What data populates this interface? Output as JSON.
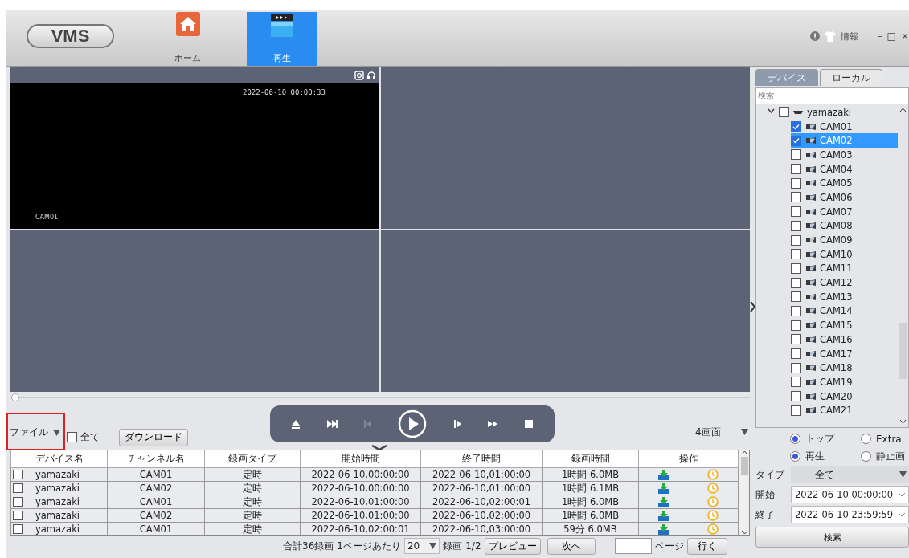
{
  "header": {
    "logo": "VMS",
    "nav": [
      {
        "label": "ホーム",
        "kind": "home",
        "selected": false
      },
      {
        "label": "再生",
        "kind": "playback",
        "selected": true
      }
    ],
    "info_label": "情報",
    "window_controls": [
      "–",
      "□",
      "×"
    ]
  },
  "video": {
    "cells": [
      {
        "kind": "live",
        "timestamp": "2022-06-10 00:00:33",
        "channel": "CAM01"
      },
      {
        "kind": "empty"
      },
      {
        "kind": "empty"
      },
      {
        "kind": "empty"
      }
    ],
    "seek": {
      "level": 0
    }
  },
  "toolbar": {
    "file_filter": {
      "value": "ファイル",
      "highlighted": true
    },
    "all_checkbox": {
      "label": "全て",
      "checked": false
    },
    "download_button": "ダウンロード",
    "layout_select": {
      "value": "4画面"
    },
    "playback_controls": [
      {
        "kind": "eject",
        "disabled": false
      },
      {
        "kind": "next",
        "disabled": false
      },
      {
        "kind": "step_back",
        "disabled": true
      },
      {
        "kind": "play",
        "disabled": false
      },
      {
        "kind": "step_forward",
        "disabled": false
      },
      {
        "kind": "fast_forward",
        "disabled": false
      },
      {
        "kind": "stop",
        "disabled": false
      }
    ]
  },
  "table": {
    "columns": [
      "デバイス名",
      "チャンネル名",
      "録画タイプ",
      "開始時間",
      "終了時間",
      "録画時間",
      "操作"
    ],
    "rows": [
      {
        "checked": false,
        "cells": [
          "yamazaki",
          "CAM01",
          "定時",
          "2022-06-10,00:00:00",
          "2022-06-10,01:00:00",
          "1時間 6.0MB"
        ]
      },
      {
        "checked": false,
        "cells": [
          "yamazaki",
          "CAM02",
          "定時",
          "2022-06-10,00:00:00",
          "2022-06-10,01:00:00",
          "1時間 6.1MB"
        ]
      },
      {
        "checked": false,
        "cells": [
          "yamazaki",
          "CAM01",
          "定時",
          "2022-06-10,01:00:00",
          "2022-06-10,02:00:01",
          "1時間 6.0MB"
        ]
      },
      {
        "checked": false,
        "cells": [
          "yamazaki",
          "CAM02",
          "定時",
          "2022-06-10,01:00:00",
          "2022-06-10,02:00:00",
          "1時間 6.0MB"
        ]
      },
      {
        "checked": false,
        "cells": [
          "yamazaki",
          "CAM01",
          "定時",
          "2022-06-10,02:00:01",
          "2022-06-10,03:00:00",
          "59分 6.0MB"
        ]
      }
    ]
  },
  "pager": {
    "total": "合計36録画",
    "per_page_label": "1ページあたり",
    "per_page": "20",
    "record_label": "録画",
    "page": "1/2",
    "prev_button": "プレビュー",
    "next_button": "次へ",
    "page_label": "ページ",
    "go_button": "行く"
  },
  "sidebar": {
    "tabs": [
      {
        "label": "デバイス",
        "selected": true
      },
      {
        "label": "ローカル",
        "selected": false
      }
    ],
    "search": {
      "placeholder": "検索"
    },
    "tree": [
      {
        "label": "yamazaki",
        "expanded": true,
        "checked": false,
        "selected": false,
        "children": [
          {
            "label": "CAM01",
            "checked": true,
            "selected": false
          },
          {
            "label": "CAM02",
            "checked": true,
            "selected": true
          },
          {
            "label": "CAM03",
            "checked": false,
            "selected": false
          },
          {
            "label": "CAM04",
            "checked": false,
            "selected": false
          },
          {
            "label": "CAM05",
            "checked": false,
            "selected": false
          },
          {
            "label": "CAM06",
            "checked": false,
            "selected": false
          },
          {
            "label": "CAM07",
            "checked": false,
            "selected": false
          },
          {
            "label": "CAM08",
            "checked": false,
            "selected": false
          },
          {
            "label": "CAM09",
            "checked": false,
            "selected": false
          },
          {
            "label": "CAM10",
            "checked": false,
            "selected": false
          },
          {
            "label": "CAM11",
            "checked": false,
            "selected": false
          },
          {
            "label": "CAM12",
            "checked": false,
            "selected": false
          },
          {
            "label": "CAM13",
            "checked": false,
            "selected": false
          },
          {
            "label": "CAM14",
            "checked": false,
            "selected": false
          },
          {
            "label": "CAM15",
            "checked": false,
            "selected": false
          },
          {
            "label": "CAM16",
            "checked": false,
            "selected": false
          },
          {
            "label": "CAM17",
            "checked": false,
            "selected": false
          },
          {
            "label": "CAM18",
            "checked": false,
            "selected": false
          },
          {
            "label": "CAM19",
            "checked": false,
            "selected": false
          },
          {
            "label": "CAM20",
            "checked": false,
            "selected": false
          },
          {
            "label": "CAM21",
            "checked": false,
            "selected": false
          }
        ]
      }
    ],
    "stream": [
      {
        "label": "トップ",
        "selected": true
      },
      {
        "label": "Extra",
        "selected": false
      }
    ],
    "mode": [
      {
        "label": "再生",
        "selected": true
      },
      {
        "label": "静止画",
        "selected": false
      }
    ],
    "type": {
      "label": "タイプ",
      "value": "全て"
    },
    "start": {
      "label": "開始",
      "value": "2022-06-10 00:00:00"
    },
    "end": {
      "label": "終了",
      "value": "2022-06-10 23:59:59"
    },
    "search_button": "検索"
  }
}
